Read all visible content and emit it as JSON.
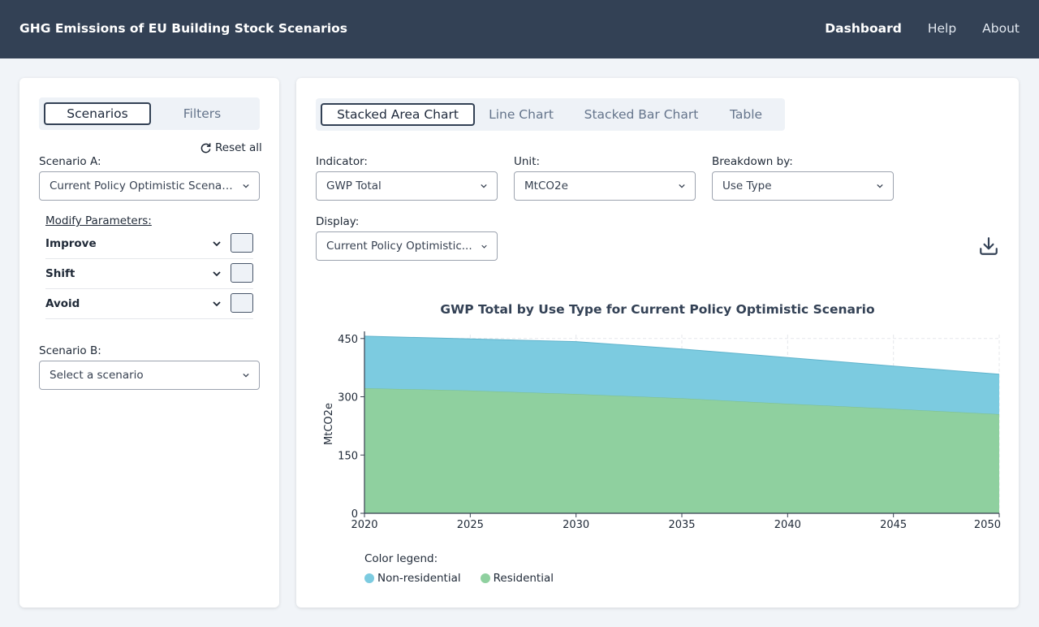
{
  "header": {
    "title": "GHG Emissions of EU Building Stock Scenarios",
    "nav": [
      "Dashboard",
      "Help",
      "About"
    ]
  },
  "left": {
    "tabs": [
      "Scenarios",
      "Filters"
    ],
    "reset_label": "Reset all",
    "scenario_a_label": "Scenario A:",
    "scenario_a_value": "Current Policy Optimistic Scenario",
    "modify_label": "Modify Parameters:",
    "params": [
      "Improve",
      "Shift",
      "Avoid"
    ],
    "scenario_b_label": "Scenario B:",
    "scenario_b_placeholder": "Select a scenario"
  },
  "right": {
    "chart_tabs": [
      "Stacked Area Chart",
      "Line Chart",
      "Stacked Bar Chart",
      "Table"
    ],
    "indicator_label": "Indicator:",
    "indicator_value": "GWP Total",
    "unit_label": "Unit:",
    "unit_value": "MtCO2e",
    "breakdown_label": "Breakdown by:",
    "breakdown_value": "Use Type",
    "display_label": "Display:",
    "display_value": "Current Policy Optimistic..."
  },
  "legend_label": "Color legend:",
  "colors": {
    "non_residential": "#7ccbe0",
    "residential": "#8fd09f",
    "header": "#334155"
  },
  "chart_data": {
    "type": "area",
    "title": "GWP Total by Use Type for Current Policy Optimistic Scenario",
    "xlabel": "",
    "ylabel": "MtCO2e",
    "x": [
      2020,
      2025,
      2030,
      2035,
      2040,
      2045,
      2050
    ],
    "xticks": [
      "2020",
      "2025",
      "2030",
      "2035",
      "2040",
      "2045",
      "2050"
    ],
    "yticks": [
      "0",
      "150",
      "300",
      "450"
    ],
    "ylim": [
      0,
      460
    ],
    "xlim": [
      2020,
      2050
    ],
    "grid": true,
    "stacked": true,
    "series": [
      {
        "name": "Residential",
        "values": [
          322,
          316,
          307,
          296,
          282,
          269,
          255
        ]
      },
      {
        "name": "Non-residential",
        "values": [
          134,
          133,
          135,
          127,
          119,
          110,
          103
        ]
      }
    ]
  }
}
